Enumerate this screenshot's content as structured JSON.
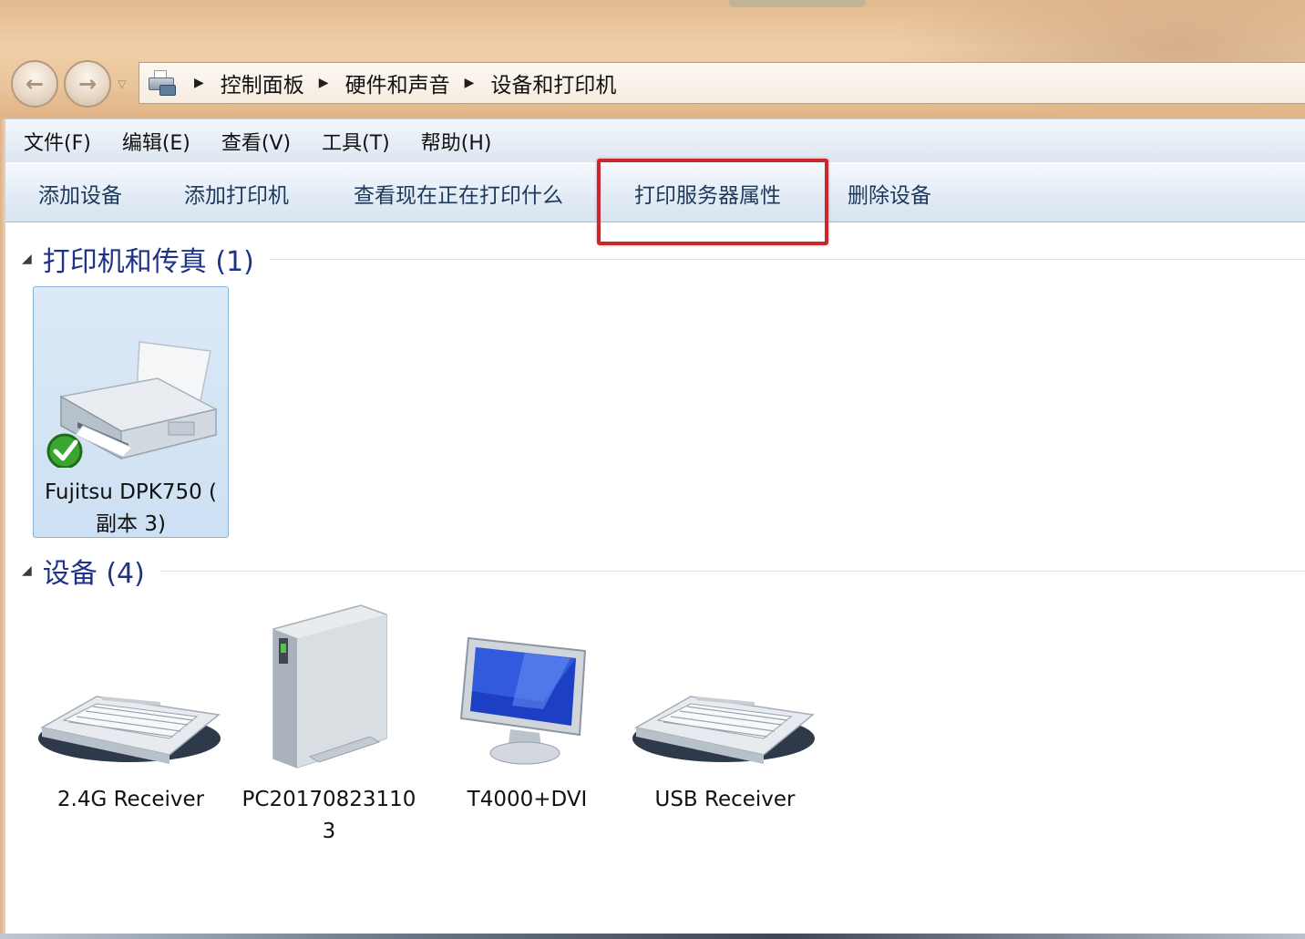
{
  "breadcrumb": {
    "items": [
      "控制面板",
      "硬件和声音",
      "设备和打印机"
    ]
  },
  "menu": {
    "file": "文件(F)",
    "edit": "编辑(E)",
    "view": "查看(V)",
    "tools": "工具(T)",
    "help": "帮助(H)"
  },
  "commands": {
    "add_device": "添加设备",
    "add_printer": "添加打印机",
    "see_printing": "查看现在正在打印什么",
    "print_server_properties": "打印服务器属性",
    "remove_device": "删除设备"
  },
  "groups": {
    "printers": {
      "label": "打印机和传真 (1)",
      "items": [
        {
          "name_line1": "Fujitsu DPK750 (",
          "name_line2": "副本 3)",
          "icon": "printer-icon",
          "status": "default-check"
        }
      ]
    },
    "devices": {
      "label": "设备 (4)",
      "items": [
        {
          "name_line1": "2.4G Receiver",
          "name_line2": "",
          "icon": "keyboard-icon"
        },
        {
          "name_line1": "PC20170823110",
          "name_line2": "3",
          "icon": "computer-tower-icon"
        },
        {
          "name_line1": "T4000+DVI",
          "name_line2": "",
          "icon": "monitor-icon"
        },
        {
          "name_line1": "USB Receiver",
          "name_line2": "",
          "icon": "keyboard-icon"
        }
      ]
    }
  },
  "colors": {
    "highlight": "#c9272b",
    "group_header_text": "#1e3287",
    "selection_bg": "#cde0f3"
  }
}
